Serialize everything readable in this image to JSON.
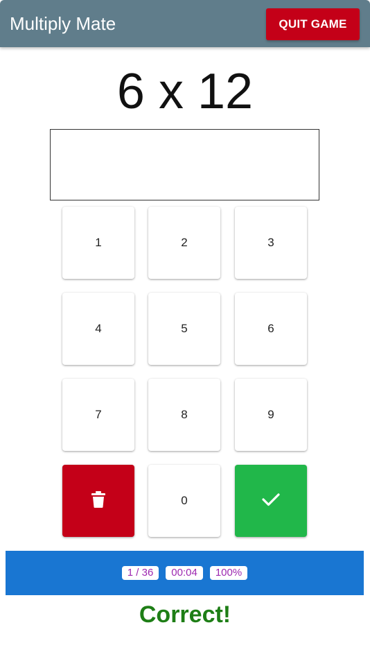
{
  "header": {
    "title": "Multiply Mate",
    "quit_label": "QUIT GAME"
  },
  "question": "6 x 12",
  "answer": {
    "value": ""
  },
  "keypad": {
    "keys": [
      "1",
      "2",
      "3",
      "4",
      "5",
      "6",
      "7",
      "8",
      "9",
      "0"
    ],
    "delete_icon": "trash-icon",
    "submit_icon": "checkmark-icon"
  },
  "status": {
    "progress": "1 / 36",
    "timer": "00:04",
    "accuracy": "100%"
  },
  "feedback": "Correct!",
  "colors": {
    "header_bg": "#607d8b",
    "quit_bg": "#c40018",
    "delete_bg": "#c40018",
    "submit_bg": "#21b74a",
    "status_bg": "#1976d2",
    "pill_text": "#9c27b0",
    "feedback_text": "#1e7e16"
  }
}
